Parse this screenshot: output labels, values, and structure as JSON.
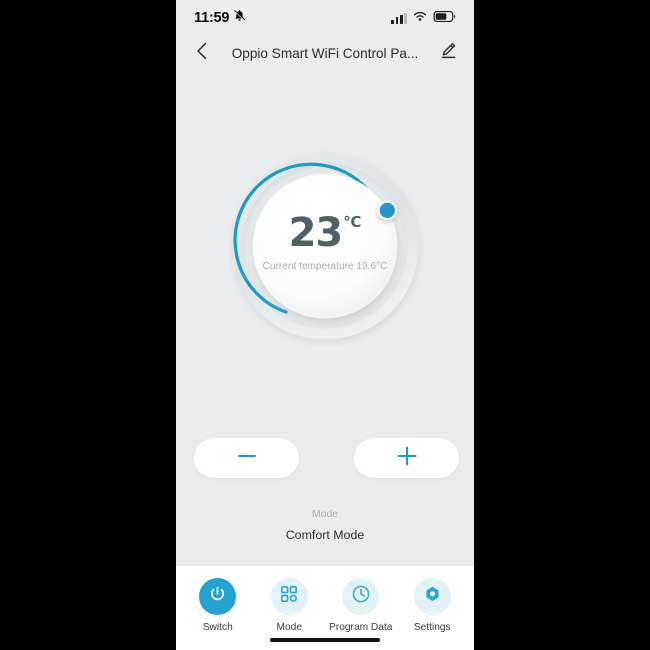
{
  "colors": {
    "accent": "#23a3cd",
    "accent_light": "#e2f2f8",
    "track": "#e0e3e5",
    "screen_bg": "#eaedee",
    "nav_bg": "#ffffff",
    "temp_text": "#4e6168",
    "muted_text": "#a4aeb3",
    "letterbox": "#000000"
  },
  "status_bar": {
    "time": "11:59",
    "mute_icon": "bell-muted-icon",
    "signal_icon": "cellular-signal-icon",
    "signal_bars_filled": 3,
    "signal_bars_total": 4,
    "wifi_icon": "wifi-icon",
    "battery_icon": "battery-icon",
    "battery_level_pct": 62
  },
  "header": {
    "back_icon": "chevron-left-icon",
    "title": "Oppio Smart WiFi Control Pa...",
    "edit_icon": "pencil-edit-icon"
  },
  "dial": {
    "target_temperature": "23",
    "unit": "℃",
    "current_temperature_text": "Current temperature 19.6°C",
    "arc_sweep_deg": 252,
    "handle_icon": "dial-handle-icon"
  },
  "stepper": {
    "minus_label": "−",
    "minus_icon": "minus-icon",
    "plus_label": "+",
    "plus_icon": "plus-icon"
  },
  "mode": {
    "label": "Mode",
    "value": "Comfort  Mode"
  },
  "bottom_nav": {
    "items": [
      {
        "label": "Switch",
        "icon": "power-icon",
        "active": true
      },
      {
        "label": "Mode",
        "icon": "grid-squares-icon",
        "active": false
      },
      {
        "label": "Program Data",
        "icon": "clock-icon",
        "active": false
      },
      {
        "label": "Settings",
        "icon": "gear-hexagon-icon",
        "active": false
      }
    ]
  }
}
